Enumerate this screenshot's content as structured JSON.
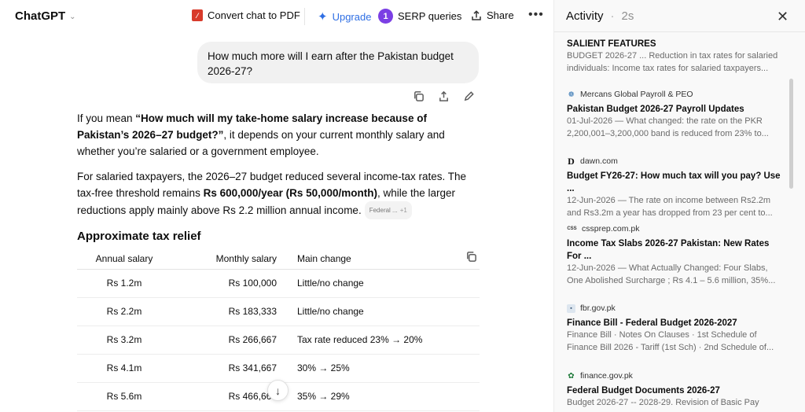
{
  "header": {
    "app_name": "ChatGPT",
    "convert_label": "Convert chat to PDF",
    "upgrade_label": "Upgrade",
    "serp_count": "1",
    "serp_label": "SERP queries",
    "share_label": "Share",
    "more_label": "•••"
  },
  "user_message": "How much more will I earn after the Pakistan budget 2026-27?",
  "answer": {
    "p1_pre": "If you mean ",
    "p1_bold": "“How much will my take-home salary increase because of Pakistan’s 2026–27 budget?”",
    "p1_post": ", it depends on your current monthly salary and whether you’re salaried or a government employee.",
    "p2_pre": "For salaried taxpayers, the 2026–27 budget reduced several income-tax rates. The tax-free threshold remains ",
    "p2_bold": "Rs 600,000/year (Rs 50,000/month)",
    "p2_post": ", while the larger reductions apply mainly above Rs 2.2 million annual income.",
    "cite_label": "Federal ...",
    "cite_more": "+1"
  },
  "table": {
    "heading": "Approximate tax relief",
    "columns": [
      "Annual salary",
      "Monthly salary",
      "Main change"
    ],
    "rows": [
      [
        "Rs 1.2m",
        "Rs 100,000",
        "Little/no change"
      ],
      [
        "Rs 2.2m",
        "Rs 183,333",
        "Little/no change"
      ],
      [
        "Rs 3.2m",
        "Rs 266,667",
        "Tax rate reduced 23% → 20%"
      ],
      [
        "Rs 4.1m",
        "Rs 341,667",
        "30% → 25%"
      ],
      [
        "Rs 5.6m",
        "Rs 466,667",
        "35% → 29%"
      ]
    ]
  },
  "scroll_down_glyph": "↓",
  "activity": {
    "title": "Activity",
    "separator": "·",
    "duration": "2s",
    "close_glyph": "✕",
    "sources": [
      {
        "site": "",
        "title": "SALIENT FEATURES",
        "snippet": "BUDGET 2026-27 ... Reduction in tax rates for salaried individuals: Income tax rates for salaried taxpayers..."
      },
      {
        "site": "Mercans Global Payroll & PEO",
        "title": "Pakistan Budget 2026-27 Payroll Updates",
        "snippet": "01-Jul-2026 — What changed: the rate on the PKR 2,200,001–3,200,000 band is reduced from 23% to..."
      },
      {
        "site": "dawn.com",
        "title": "Budget FY26-27: How much tax will you pay? Use ...",
        "snippet": "12-Jun-2026 — The rate on income between Rs2.2m and Rs3.2m a year has dropped from 23 per cent to..."
      },
      {
        "site": "cssprep.com.pk",
        "title": "Income Tax Slabs 2026-27 Pakistan: New Rates For ...",
        "snippet": "12-Jun-2026 — What Actually Changed: Four Slabs, One Abolished Surcharge ; Rs 4.1 – 5.6 million, 35%..."
      },
      {
        "site": "fbr.gov.pk",
        "title": "Finance Bill - Federal Budget 2026-2027",
        "snippet": "Finance Bill · Notes On Clauses · 1st Schedule of Finance Bill 2026 - Tariff (1st Sch) · 2nd Schedule of..."
      },
      {
        "site": "finance.gov.pk",
        "title": "Federal Budget Documents 2026-27",
        "snippet": "Budget 2026-27 -- 2028-29. Revision of Basic Pay"
      }
    ]
  }
}
